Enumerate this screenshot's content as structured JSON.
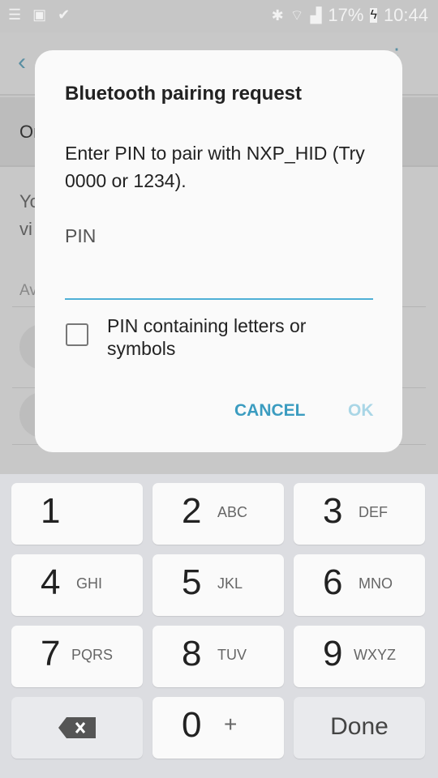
{
  "status_bar": {
    "icons_left": [
      "notification-list-icon",
      "image-icon",
      "task-check-icon"
    ],
    "icons_right": [
      "bluetooth-icon",
      "wifi-icon",
      "signal-icon"
    ],
    "battery": "17%",
    "time": "10:44"
  },
  "background": {
    "on_label": "On",
    "desc_line1": "Yo",
    "desc_line2": "vi",
    "section_header": "Av"
  },
  "dialog": {
    "title": "Bluetooth pairing request",
    "message": "Enter PIN to pair with NXP_HID (Try 0000 or 1234).",
    "pin_label": "PIN",
    "pin_value": "",
    "checkbox_label": "PIN containing letters or symbols",
    "checkbox_checked": false,
    "cancel": "CANCEL",
    "ok": "OK",
    "accent": "#3b9cc0",
    "ok_disabled_color": "#a9d6e6"
  },
  "keypad": {
    "keys": [
      {
        "n": "1",
        "s": ""
      },
      {
        "n": "2",
        "s": "ABC"
      },
      {
        "n": "3",
        "s": "DEF"
      },
      {
        "n": "4",
        "s": "GHI"
      },
      {
        "n": "5",
        "s": "JKL"
      },
      {
        "n": "6",
        "s": "MNO"
      },
      {
        "n": "7",
        "s": "PQRS"
      },
      {
        "n": "8",
        "s": "TUV"
      },
      {
        "n": "9",
        "s": "WXYZ"
      },
      {
        "n": "0",
        "s": "+"
      }
    ],
    "done": "Done"
  }
}
